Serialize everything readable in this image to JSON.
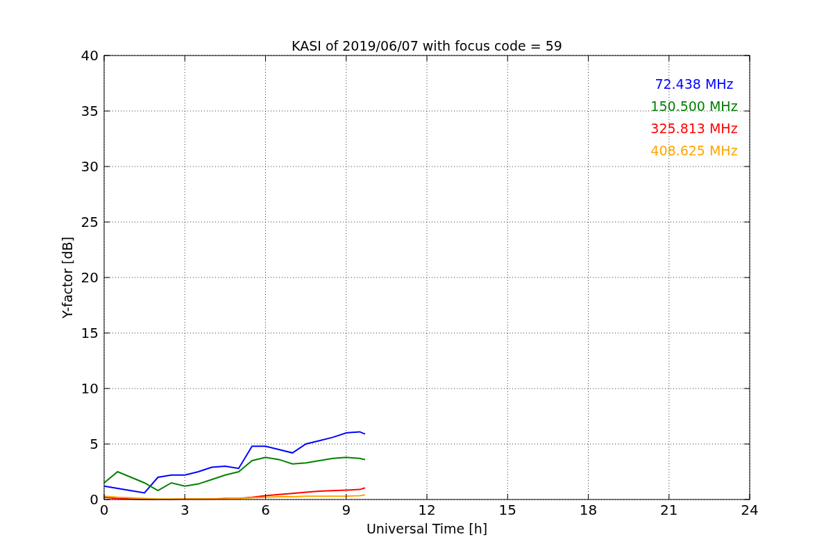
{
  "figure": {
    "chart_data": {
      "type": "line",
      "title": "KASI of 2019/06/07 with focus code = 59",
      "xlabel": "Universal Time [h]",
      "ylabel": "Y-factor [dB]",
      "x": [
        0,
        0.5,
        1,
        1.5,
        2,
        2.5,
        3,
        3.5,
        4,
        4.5,
        5,
        5.5,
        6,
        6.5,
        7,
        7.5,
        8,
        8.5,
        9,
        9.5,
        9.7
      ],
      "series": [
        {
          "name": "72.438 MHz",
          "color": "#0000ff",
          "values": [
            1.2,
            1.0,
            0.8,
            0.6,
            2.0,
            2.2,
            2.2,
            2.5,
            2.9,
            3.0,
            2.8,
            4.8,
            4.8,
            4.5,
            4.2,
            5.0,
            5.3,
            5.6,
            6.0,
            6.1,
            5.9
          ]
        },
        {
          "name": "150.500 MHz",
          "color": "#008000",
          "values": [
            1.5,
            2.5,
            2.0,
            1.5,
            0.8,
            1.5,
            1.2,
            1.4,
            1.8,
            2.2,
            2.5,
            3.5,
            3.8,
            3.6,
            3.2,
            3.3,
            3.5,
            3.7,
            3.8,
            3.7,
            3.6
          ]
        },
        {
          "name": "325.813 MHz",
          "color": "#ff0000",
          "values": [
            0.2,
            0.1,
            0.05,
            0.0,
            0.0,
            0.0,
            0.05,
            0.05,
            0.05,
            0.1,
            0.1,
            0.2,
            0.35,
            0.45,
            0.55,
            0.65,
            0.75,
            0.8,
            0.85,
            0.9,
            1.05
          ]
        },
        {
          "name": "408.625 MHz",
          "color": "#ffa500",
          "values": [
            0.3,
            0.2,
            0.15,
            0.1,
            0.05,
            0.05,
            0.05,
            0.05,
            0.05,
            0.05,
            0.1,
            0.15,
            0.2,
            0.25,
            0.25,
            0.3,
            0.3,
            0.3,
            0.3,
            0.35,
            0.4
          ]
        }
      ],
      "xlim": [
        0,
        24
      ],
      "ylim": [
        0,
        40
      ],
      "xticks": [
        0,
        3,
        6,
        9,
        12,
        15,
        18,
        21,
        24
      ],
      "yticks": [
        0,
        5,
        10,
        15,
        20,
        25,
        30,
        35,
        40
      ],
      "grid": true
    }
  }
}
